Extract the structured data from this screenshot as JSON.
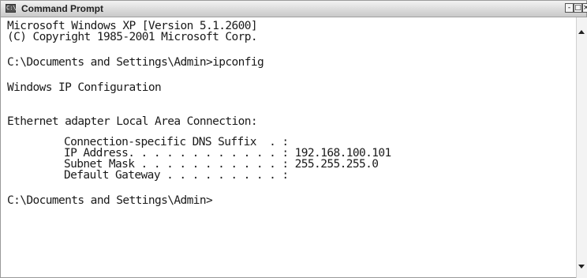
{
  "window": {
    "title": "Command Prompt",
    "icon_text": "C:\\",
    "controls": {
      "minimize": "-",
      "maximize": "□",
      "close": "×"
    }
  },
  "console": {
    "line1": "Microsoft Windows XP [Version 5.1.2600]",
    "line2": "(C) Copyright 1985-2001 Microsoft Corp.",
    "prompt1": "C:\\Documents and Settings\\Admin>ipconfig",
    "ip_config_header": "Windows IP Configuration",
    "adapter_header": "Ethernet adapter Local Area Connection:",
    "dns_suffix": "Connection-specific DNS Suffix  . :",
    "ip_address": "IP Address. . . . . . . . . . . . : 192.168.100.101",
    "subnet_mask": "Subnet Mask . . . . . . . . . . . : 255.255.255.0",
    "default_gateway": "Default Gateway . . . . . . . . . :",
    "prompt2": "C:\\Documents and Settings\\Admin>"
  },
  "icons": {
    "app": "command-prompt-icon",
    "scroll_up": "scroll-up-arrow-icon",
    "scroll_down": "scroll-down-arrow-icon"
  }
}
